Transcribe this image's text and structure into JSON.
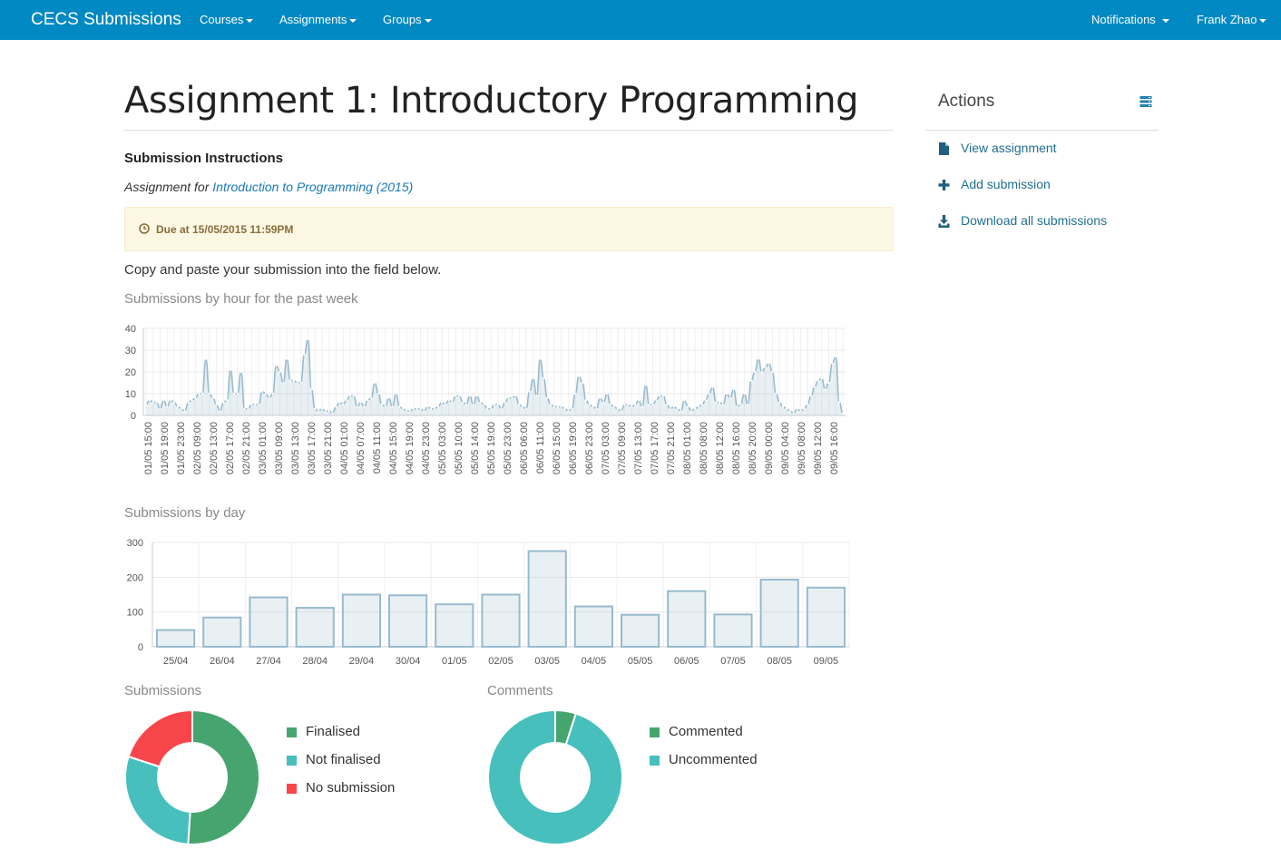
{
  "navbar": {
    "brand": "CECS Submissions",
    "items": [
      "Courses",
      "Assignments",
      "Groups"
    ],
    "notifications": "Notifications",
    "user": "Frank Zhao",
    "color": "#0089c3"
  },
  "page": {
    "title": "Assignment 1: Introductory Programming",
    "section_heading": "Submission Instructions",
    "assignment_for_prefix": "Assignment for",
    "course_link": "Introduction to Programming (2015)",
    "due": "Due at 15/05/2015 11:59PM",
    "instructions": "Copy and paste your submission into the field below."
  },
  "actions": {
    "title": "Actions",
    "links": [
      {
        "label": "View assignment",
        "icon": "file-icon"
      },
      {
        "label": "Add submission",
        "icon": "plus-icon"
      },
      {
        "label": "Download all submissions",
        "icon": "download-icon"
      }
    ]
  },
  "chart_data": [
    {
      "type": "area",
      "title": "Submissions by hour for the past week",
      "ylim": [
        0,
        40
      ],
      "yticks": [
        0,
        10,
        20,
        30,
        40
      ],
      "x_tick_labels": [
        "01/05 15:00",
        "01/05 19:00",
        "01/05 23:00",
        "02/05 09:00",
        "02/05 13:00",
        "02/05 17:00",
        "02/05 21:00",
        "03/05 01:00",
        "03/05 09:00",
        "03/05 13:00",
        "03/05 17:00",
        "03/05 21:00",
        "04/05 01:00",
        "04/05 07:00",
        "04/05 11:00",
        "04/05 15:00",
        "04/05 19:00",
        "04/05 23:00",
        "05/05 03:00",
        "05/05 10:00",
        "05/05 14:00",
        "05/05 19:00",
        "05/05 23:00",
        "06/05 06:00",
        "06/05 11:00",
        "06/05 15:00",
        "06/05 19:00",
        "06/05 23:00",
        "07/05 03:00",
        "07/05 09:00",
        "07/05 13:00",
        "07/05 17:00",
        "07/05 21:00",
        "08/05 01:00",
        "08/05 08:00",
        "08/05 12:00",
        "08/05 16:00",
        "08/05 20:00",
        "09/05 00:00",
        "09/05 04:00",
        "09/05 08:00",
        "09/05 12:00",
        "09/05 16:00"
      ],
      "values": [
        5,
        7,
        6,
        6,
        3,
        7,
        4,
        7,
        6,
        4,
        3,
        2,
        6,
        7,
        8,
        10,
        10,
        26,
        10,
        8,
        5,
        2,
        6,
        7,
        21,
        10,
        10,
        20,
        3,
        3,
        5,
        5,
        5,
        11,
        10,
        8,
        10,
        23,
        20,
        15,
        26,
        16,
        16,
        15,
        15,
        28,
        35,
        12,
        3,
        2,
        3,
        2,
        2,
        1,
        4,
        6,
        5,
        7,
        9,
        9,
        4,
        6,
        4,
        7,
        8,
        15,
        10,
        5,
        4,
        8,
        4,
        10,
        4,
        3,
        2,
        2,
        3,
        3,
        3,
        2,
        4,
        3,
        3,
        4,
        6,
        5,
        7,
        6,
        9,
        9,
        6,
        5,
        9,
        5,
        9,
        6,
        5,
        3,
        3,
        5,
        5,
        3,
        6,
        8,
        8,
        9,
        5,
        4,
        3,
        11,
        17,
        9,
        26,
        17,
        8,
        5,
        4,
        4,
        4,
        3,
        2,
        3,
        10,
        18,
        15,
        7,
        5,
        4,
        3,
        8,
        6,
        10,
        5,
        4,
        3,
        2,
        5,
        5,
        4,
        5,
        7,
        4,
        14,
        5,
        5,
        7,
        9,
        9,
        5,
        3,
        4,
        3,
        2,
        7,
        4,
        2,
        3,
        4,
        5,
        7,
        10,
        13,
        6,
        6,
        5,
        10,
        8,
        12,
        4,
        5,
        10,
        5,
        16,
        20,
        26,
        20,
        22,
        24,
        20,
        10,
        6,
        4,
        3,
        2,
        1,
        3,
        2,
        3,
        5,
        9,
        13,
        16,
        17,
        12,
        15,
        24,
        27,
        6,
        1
      ],
      "color": "#97bbcd"
    },
    {
      "type": "bar",
      "title": "Submissions by day",
      "categories": [
        "25/04",
        "26/04",
        "27/04",
        "28/04",
        "29/04",
        "30/04",
        "01/05",
        "02/05",
        "03/05",
        "04/05",
        "05/05",
        "06/05",
        "07/05",
        "08/05",
        "09/05"
      ],
      "values": [
        48,
        84,
        142,
        112,
        150,
        148,
        122,
        150,
        275,
        116,
        92,
        160,
        93,
        193,
        170
      ],
      "ylim": [
        0,
        300
      ],
      "yticks": [
        0,
        100,
        200,
        300
      ],
      "color": "#97bbcd"
    },
    {
      "type": "pie",
      "title": "Submissions",
      "labels": [
        "Finalised",
        "Not finalised",
        "No submission"
      ],
      "values": [
        51,
        29,
        20
      ],
      "colors": [
        "#46a56f",
        "#46bfbd",
        "#f7464a"
      ]
    },
    {
      "type": "pie",
      "title": "Comments",
      "labels": [
        "Commented",
        "Uncommented"
      ],
      "values": [
        5,
        95
      ],
      "colors": [
        "#46a56f",
        "#46bfbd"
      ]
    }
  ]
}
